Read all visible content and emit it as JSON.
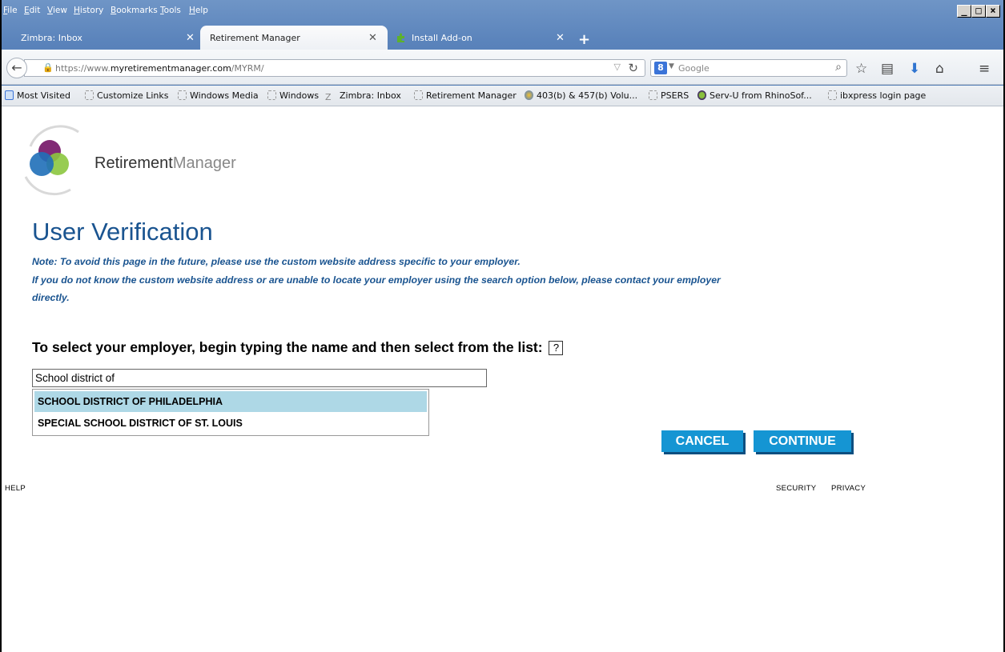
{
  "menu": {
    "items": [
      "File",
      "Edit",
      "View",
      "History",
      "Bookmarks",
      "Tools",
      "Help"
    ]
  },
  "window_controls": [
    "minimize",
    "maximize",
    "close"
  ],
  "tabs": [
    {
      "label": "Zimbra: Inbox",
      "active": false
    },
    {
      "label": "Retirement Manager",
      "active": true
    },
    {
      "label": "Install Add-on",
      "active": false
    }
  ],
  "nav": {
    "url_prefix": "https://www.",
    "url_domain": "myretirementmanager.com",
    "url_path": "/MYRM/",
    "search_engine": "8",
    "search_placeholder": "Google"
  },
  "bookmarks": [
    "Most Visited",
    "Customize Links",
    "Windows Media",
    "Windows",
    "Zimbra: Inbox",
    "Retirement Manager",
    "403(b) & 457(b) Volu...",
    "PSERS",
    "Serv-U from RhinoSof...",
    "ibxpress login page"
  ],
  "logo": {
    "text_main": "Retirement",
    "text_sub": "Manager"
  },
  "page": {
    "title": "User Verification",
    "note_line1": "Note: To avoid this page in the future, please use the custom website address specific to your employer.",
    "note_line2": "If you do not know the custom website address or are unable to locate your employer using the search option below, please contact your employer",
    "note_line3": "directly.",
    "prompt": "To select your employer, begin typing the name and then select from the list:",
    "help_glyph": "?",
    "employer_input_value": "School district of",
    "suggestions": [
      {
        "label": "SCHOOL DISTRICT OF PHILADELPHIA",
        "highlighted": true
      },
      {
        "label": "SPECIAL SCHOOL DISTRICT OF ST. LOUIS",
        "highlighted": false
      }
    ],
    "cancel_label": "CANCEL",
    "continue_label": "CONTINUE"
  },
  "footer": {
    "help": "HELP",
    "security": "SECURITY",
    "privacy": "PRIVACY"
  },
  "colors": {
    "heading_blue": "#1a5490",
    "button_blue": "#1595d3",
    "suggestion_highlight": "#aed8e6",
    "chrome_blue": "#5a83bb"
  }
}
